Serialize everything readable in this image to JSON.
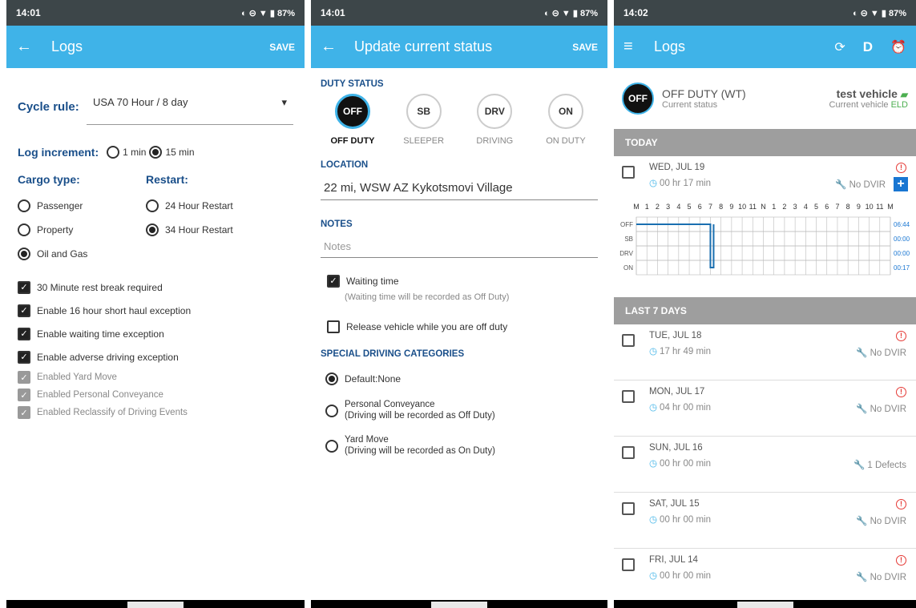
{
  "panel1": {
    "status": {
      "time": "14:01",
      "indicators": "◐ ⊝ ▼ ▮ 87%"
    },
    "appbar": {
      "title": "Logs",
      "save": "SAVE"
    },
    "cycle_label": "Cycle rule:",
    "cycle_value": "USA 70 Hour / 8 day",
    "log_increment_label": "Log increment:",
    "log_increment_options": [
      "1 min",
      "15 min"
    ],
    "cargo_label": "Cargo type:",
    "cargo_options": [
      "Passenger",
      "Property",
      "Oil and Gas"
    ],
    "restart_label": "Restart:",
    "restart_options": [
      "24 Hour Restart",
      "34 Hour Restart"
    ],
    "checks": [
      "30 Minute rest break required",
      "Enable 16 hour short haul exception",
      "Enable waiting time exception",
      "Enable adverse driving exception"
    ],
    "disabled_checks": [
      "Enabled Yard Move",
      "Enabled Personal Conveyance",
      "Enabled Reclassify of Driving Events"
    ]
  },
  "panel2": {
    "status": {
      "time": "14:01",
      "indicators": "◐ ⊝ ▼ ▮ 87%"
    },
    "appbar": {
      "title": "Update current status",
      "save": "SAVE"
    },
    "duty_status_label": "DUTY STATUS",
    "duty": [
      {
        "code": "OFF",
        "label": "OFF DUTY"
      },
      {
        "code": "SB",
        "label": "SLEEPER"
      },
      {
        "code": "DRV",
        "label": "DRIVING"
      },
      {
        "code": "ON",
        "label": "ON DUTY"
      }
    ],
    "location_label": "LOCATION",
    "location_value": "22 mi, WSW AZ Kykotsmovi Village",
    "notes_label": "NOTES",
    "notes_placeholder": "Notes",
    "waiting_label": "Waiting time",
    "waiting_sub": "(Waiting time will be recorded as Off Duty)",
    "release_label": "Release vehicle while you are off duty",
    "special_label": "SPECIAL DRIVING CATEGORIES",
    "special_default": "Default:None",
    "pc_line1": "Personal Conveyance",
    "pc_line2": "(Driving will be recorded as Off Duty)",
    "ym_line1": "Yard Move",
    "ym_line2": "(Driving will be recorded as On Duty)"
  },
  "panel3": {
    "status": {
      "time": "14:02",
      "indicators": "◐ ⊝ ▼ ▮ 87%"
    },
    "appbar": {
      "title": "Logs",
      "d": "D"
    },
    "current_code": "OFF",
    "current_status": "OFF DUTY (WT)",
    "current_status_sub": "Current status",
    "vehicle": "test vehicle",
    "vehicle_sub": "Current vehicle",
    "eld": "ELD",
    "today_label": "TODAY",
    "today": {
      "date": "WED, JUL 19",
      "dur": "00 hr 17 min",
      "dvir": "No DVIR"
    },
    "graph": {
      "hours": [
        "M",
        "1",
        "2",
        "3",
        "4",
        "5",
        "6",
        "7",
        "8",
        "9",
        "10",
        "11",
        "N",
        "1",
        "2",
        "3",
        "4",
        "5",
        "6",
        "7",
        "8",
        "9",
        "10",
        "11",
        "M"
      ],
      "rows": [
        "OFF",
        "SB",
        "DRV",
        "ON"
      ],
      "totals": [
        "06:44",
        "00:00",
        "00:00",
        "00:17"
      ]
    },
    "last7_label": "LAST 7 DAYS",
    "days": [
      {
        "date": "TUE, JUL 18",
        "dur": "17 hr 49 min",
        "dvir": "No DVIR"
      },
      {
        "date": "MON, JUL 17",
        "dur": "04 hr 00 min",
        "dvir": "No DVIR"
      },
      {
        "date": "SUN, JUL 16",
        "dur": "00 hr 00 min",
        "dvir": "1 Defects"
      },
      {
        "date": "SAT, JUL 15",
        "dur": "00 hr 00 min",
        "dvir": "No DVIR"
      },
      {
        "date": "FRI, JUL 14",
        "dur": "00 hr 00 min",
        "dvir": "No DVIR"
      }
    ]
  }
}
